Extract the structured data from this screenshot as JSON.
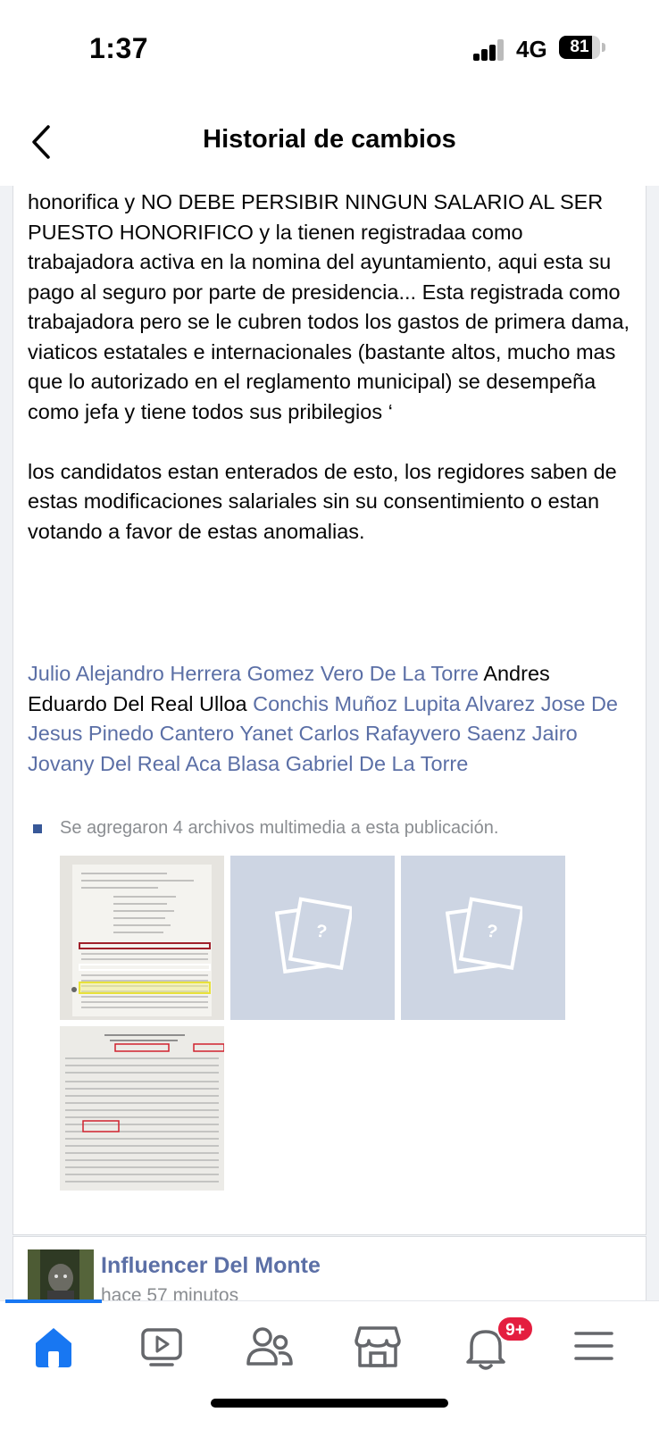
{
  "status": {
    "time": "1:37",
    "network": "4G",
    "battery": "81",
    "battery_level": 0.81
  },
  "header": {
    "title": "Historial de cambios"
  },
  "post": {
    "body": "honorifica y NO DEBE PERSIBIR NINGUN SALARIO AL SER PUESTO HONORIFICO y la tienen registradaa como trabajadora activa en la nomina del ayuntamiento, aqui esta su pago al seguro por parte de presidencia... Esta registrada como trabajadora pero se le cubren todos los gastos de primera dama, viaticos estatales e internacionales (bastante altos, mucho mas que lo autorizado en el reglamento municipal) se desempeña como jefa y tiene todos sus pribilegios ‘\n\nlos candidatos estan enterados de esto, los regidores saben de estas modificaciones salariales sin su consentimiento o estan votando a favor de estas anomalias.",
    "tags": [
      {
        "text": "Julio Alejandro Herrera Gomez",
        "linked": true
      },
      {
        "text": "Vero De La Torre",
        "linked": true
      },
      {
        "text": "Andres Eduardo Del Real Ulloa",
        "linked": false
      },
      {
        "text": "Conchis Muñoz",
        "linked": true
      },
      {
        "text": "Lupita Alvarez",
        "linked": true
      },
      {
        "text": "Jose De Jesus Pinedo Cantero",
        "linked": true
      },
      {
        "text": "Yanet Carlos Rafayvero Saenz",
        "linked": true
      },
      {
        "text": "Jairo Jovany Del Real Aca",
        "linked": true
      },
      {
        "text": "Blasa Gabriel De La Torre",
        "linked": true
      }
    ],
    "media_note": "Se agregaron 4 archivos multimedia a esta publicación."
  },
  "next_post": {
    "author": "Influencer Del Monte",
    "time_ago": "hace 57 minutos"
  },
  "tabbar": {
    "tabs": [
      "home-icon",
      "video-icon",
      "friends-icon",
      "marketplace-icon",
      "notifications-icon",
      "menu-icon"
    ],
    "notification_badge": "9+",
    "accent": "#1877f2"
  }
}
